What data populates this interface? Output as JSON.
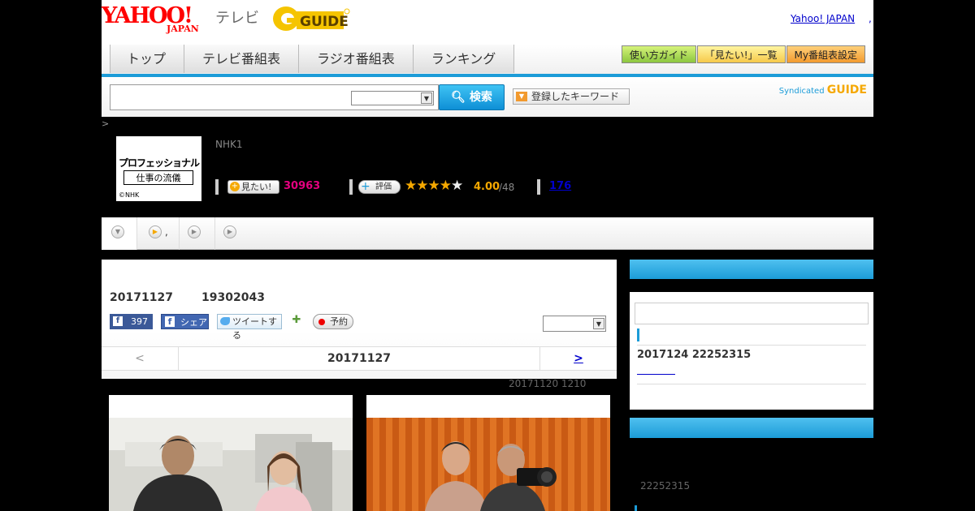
{
  "header": {
    "yahoo_logo": "YAHOO!",
    "yahoo_japan": "JAPAN",
    "tv_label": "テレビ",
    "gguide_logo": "GUIDE",
    "yahoo_japan_link": "Yahoo! JAPAN",
    "trailing_comma": ","
  },
  "nav": {
    "tabs": [
      "トップ",
      "テレビ番組表",
      "ラジオ番組表",
      "ランキング"
    ],
    "buttons": [
      "使い方ガイド",
      "「見たい!」一覧",
      "My番組表設定"
    ]
  },
  "search": {
    "button_label": "検索",
    "keyword_button": "登録したキーワード",
    "syndicated_label": "Syndicated",
    "syndicated_logo": "GUIDE"
  },
  "breadcrumb": ">",
  "program": {
    "thumb_title": "プロフェッショナル",
    "thumb_subtitle": "仕事の流儀",
    "thumb_copyright": "©NHK",
    "channel": "NHK1",
    "want_label": "見たい!",
    "want_count": "30963",
    "rate_label": "評価",
    "rating_value": "4.00",
    "rating_total": "/48",
    "rating_stars": 4,
    "review_count": "176"
  },
  "subtabs": [
    ",",
    "",
    ""
  ],
  "main": {
    "air_date": "20171127",
    "air_time": "19302043",
    "fb_like_count": "397",
    "fb_share_label": "シェア",
    "tweet_label": "ツイートする",
    "reserve_label": "予約",
    "prev_label": "<",
    "current_date": "20171127",
    "next_label": ">",
    "update_note": "20171120  1210"
  },
  "sidebar": {
    "air_date_time": "2017124  22252315",
    "second_box_text": "22252315"
  },
  "colors": {
    "accent_blue": "#1c9cd8",
    "want_pink": "#e4007f",
    "star_orange": "#f5a800",
    "link_blue": "#0000cc"
  }
}
